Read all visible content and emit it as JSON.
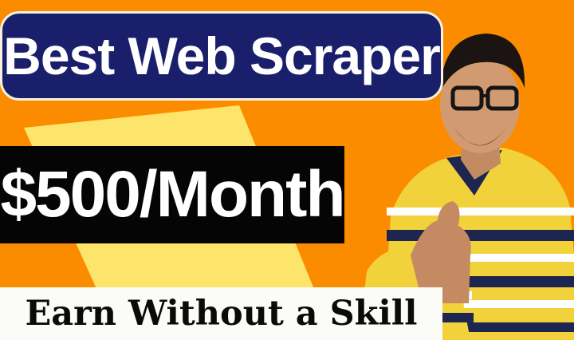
{
  "thumbnail": {
    "headline": "Best Web Scraper",
    "price": "$500/Month",
    "tagline": "Earn Without a Skill"
  },
  "colors": {
    "background": "#fb8c00",
    "accent_yellow": "#fde56b",
    "title_pill_bg": "#1a1f6b",
    "price_box_bg": "#050505",
    "tagline_bg": "#fbfbf7",
    "shirt_yellow": "#f2d23a",
    "shirt_navy": "#1d2651"
  }
}
